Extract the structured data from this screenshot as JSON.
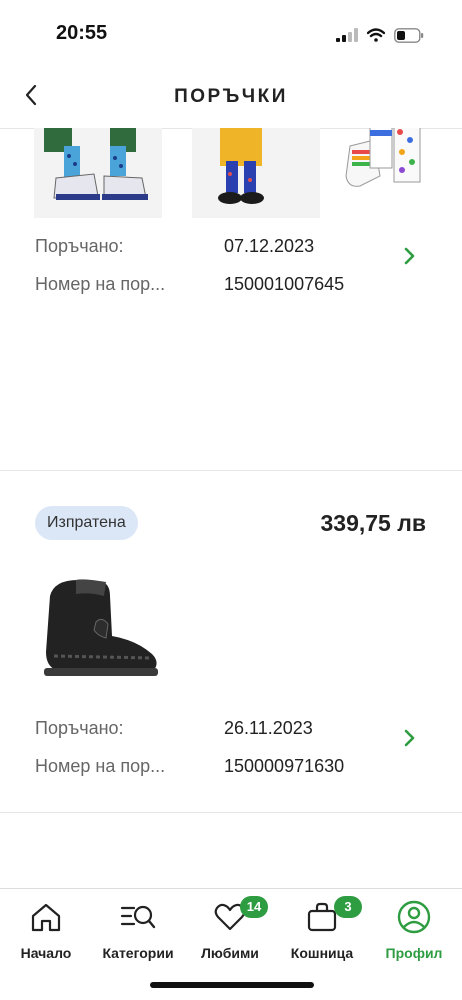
{
  "status_bar": {
    "time": "20:55"
  },
  "header": {
    "title": "ПОРЪЧКИ"
  },
  "orders": [
    {
      "ordered_label": "Поръчано:",
      "ordered_date": "07.12.2023",
      "number_label": "Номер на пор...",
      "number_value": "150001007645"
    },
    {
      "status": "Изпратена",
      "price": "339,75 лв",
      "ordered_label": "Поръчано:",
      "ordered_date": "26.11.2023",
      "number_label": "Номер на пор...",
      "number_value": "150000971630"
    }
  ],
  "bottom_nav": {
    "items": [
      {
        "label": "Начало",
        "icon": "home-icon"
      },
      {
        "label": "Категории",
        "icon": "categories-search-icon"
      },
      {
        "label": "Любими",
        "icon": "heart-icon",
        "badge": "14"
      },
      {
        "label": "Кошница",
        "icon": "bag-icon",
        "badge": "3"
      },
      {
        "label": "Профил",
        "icon": "profile-icon",
        "active": true
      }
    ]
  },
  "colors": {
    "accent": "#2e9c41",
    "badge_bg": "#dbe7f7"
  }
}
